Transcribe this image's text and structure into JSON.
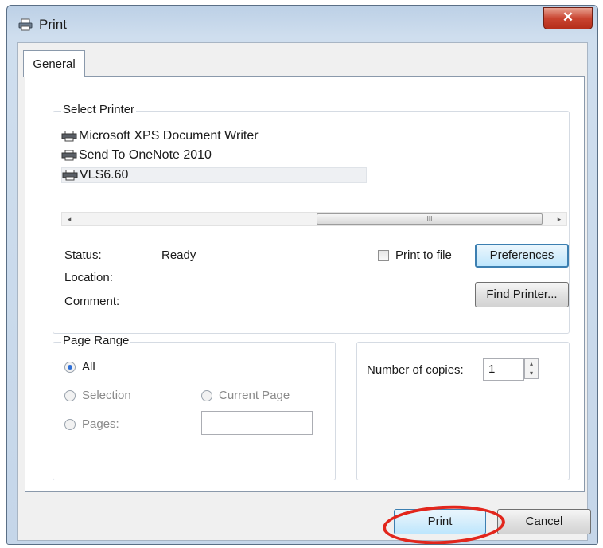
{
  "window": {
    "title": "Print",
    "close_glyph": "✕"
  },
  "tabs": [
    {
      "label": "General",
      "active": true
    }
  ],
  "select_printer": {
    "legend": "Select Printer",
    "printers": [
      {
        "name": "Microsoft XPS Document Writer",
        "selected": false
      },
      {
        "name": "Send To OneNote 2010",
        "selected": false
      },
      {
        "name": "VLS6.60",
        "selected": true
      }
    ],
    "scroll_left": "◂",
    "scroll_right": "▸",
    "scroll_grip": "III",
    "status_label": "Status:",
    "status_value": "Ready",
    "location_label": "Location:",
    "location_value": "",
    "comment_label": "Comment:",
    "comment_value": "",
    "print_to_file_label": "Print to file",
    "print_to_file_checked": false,
    "preferences_label": "Preferences",
    "find_printer_label": "Find Printer..."
  },
  "page_range": {
    "legend": "Page Range",
    "all_label": "All",
    "selection_label": "Selection",
    "current_page_label": "Current Page",
    "pages_label": "Pages:",
    "pages_value": "",
    "selected": "All"
  },
  "copies": {
    "label": "Number of copies:",
    "value": "1",
    "up": "▴",
    "down": "▾"
  },
  "footer": {
    "print_label": "Print",
    "cancel_label": "Cancel"
  },
  "colors": {
    "annotation_ring": "#e2261c",
    "focus_border": "#3c7fb1"
  }
}
